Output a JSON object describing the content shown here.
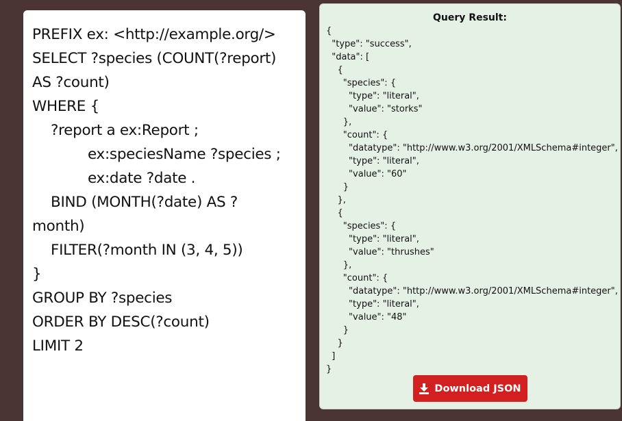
{
  "query_editor": {
    "lines": [
      "PREFIX ex: <http://example.org/>",
      "SELECT ?species (COUNT(?report)",
      "AS ?count)",
      "WHERE {",
      "?report a ex:Report ;",
      "ex:speciesName ?species ;",
      "ex:date ?date .",
      "BIND (MONTH(?date) AS ?",
      "month)",
      "FILTER(?month IN (3, 4, 5))",
      "}",
      "GROUP BY ?species",
      "ORDER BY DESC(?count)",
      "LIMIT 2"
    ]
  },
  "result_panel": {
    "title": "Query Result:",
    "json_text": "{\n  \"type\": \"success\",\n  \"data\": [\n    {\n      \"species\": {\n        \"type\": \"literal\",\n        \"value\": \"storks\"\n      },\n      \"count\": {\n        \"datatype\": \"http://www.w3.org/2001/XMLSchema#integer\",\n        \"type\": \"literal\",\n        \"value\": \"60\"\n      }\n    },\n    {\n      \"species\": {\n        \"type\": \"literal\",\n        \"value\": \"thrushes\"\n      },\n      \"count\": {\n        \"datatype\": \"http://www.w3.org/2001/XMLSchema#integer\",\n        \"type\": \"literal\",\n        \"value\": \"48\"\n      }\n    }\n  ]\n}",
    "download_label": "Download JSON",
    "download_icon": "download-icon"
  },
  "colors": {
    "page_background": "#4a3434",
    "result_background": "#e6f1e6",
    "button_background": "#d21f1f"
  }
}
